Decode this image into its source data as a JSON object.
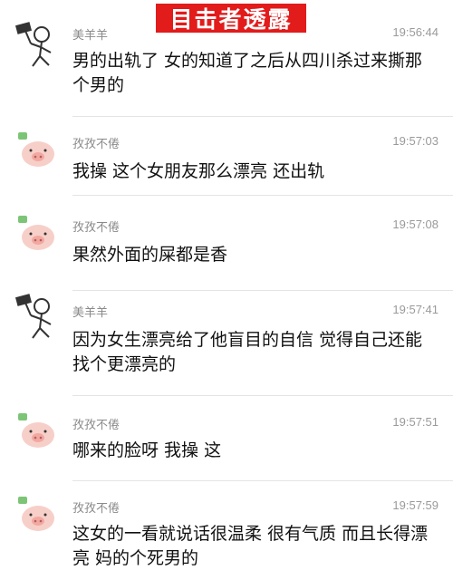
{
  "banner": {
    "text": "目击者透露"
  },
  "messages": [
    {
      "avatar": "stick-figure-hammer-icon",
      "name": "美羊羊",
      "time": "19:56:44",
      "text": "男的出轨了 女的知道了之后从四川杀过来撕那个男的"
    },
    {
      "avatar": "pig-icon",
      "name": "孜孜不倦",
      "time": "19:57:03",
      "text": "我操 这个女朋友那么漂亮 还出轨"
    },
    {
      "avatar": "pig-icon",
      "name": "孜孜不倦",
      "time": "19:57:08",
      "text": "果然外面的屎都是香"
    },
    {
      "avatar": "stick-figure-hammer-icon",
      "name": "美羊羊",
      "time": "19:57:41",
      "text": "因为女生漂亮给了他盲目的自信 觉得自己还能找个更漂亮的"
    },
    {
      "avatar": "pig-icon",
      "name": "孜孜不倦",
      "time": "19:57:51",
      "text": "哪来的脸呀 我操 这"
    },
    {
      "avatar": "pig-icon",
      "name": "孜孜不倦",
      "time": "19:57:59",
      "text": "这女的一看就说话很温柔 很有气质 而且长得漂亮 妈的个死男的"
    }
  ]
}
